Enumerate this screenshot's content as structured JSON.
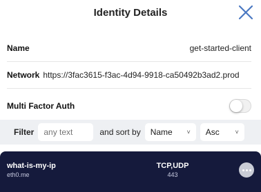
{
  "header": {
    "title": "Identity Details"
  },
  "details": {
    "name_label": "Name",
    "name_value": "get-started-client",
    "network_label": "Network",
    "network_value": "https://3fac3615-f3ac-4d94-9918-ca50492b3ad2.prod",
    "mfa_label": "Multi Factor Auth",
    "mfa_enabled": false
  },
  "filter": {
    "label": "Filter",
    "placeholder": "any text",
    "sort_label": "and sort by",
    "sort_value": "Name",
    "order_value": "Asc"
  },
  "services": [
    {
      "name": "what-is-my-ip",
      "host": "eth0.me",
      "protocol": "TCP,UDP",
      "port": "443"
    }
  ],
  "colors": {
    "list_bg": "#151a3c",
    "filter_bg": "#eef0f3",
    "close_icon": "#4a78c2"
  }
}
